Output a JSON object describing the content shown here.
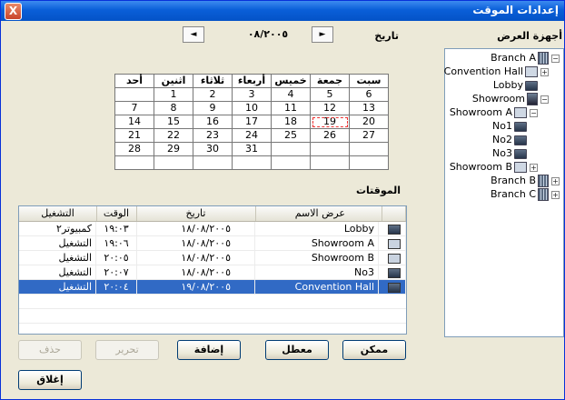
{
  "window": {
    "title": "إعدادات الموقت",
    "close_label": "X"
  },
  "devices": {
    "label": "أجهزة العرض",
    "items": [
      {
        "name": "Branch A",
        "icon": "building-icon",
        "expander": "−"
      },
      {
        "name": "Convention Hall",
        "icon": "display-icon",
        "expander": "+"
      },
      {
        "name": "Lobby",
        "icon": "video-icon",
        "expander": ""
      },
      {
        "name": "Showroom",
        "icon": "showroom-icon",
        "expander": "−"
      },
      {
        "name": "Showroom A",
        "icon": "display-icon",
        "expander": "−"
      },
      {
        "name": "No1",
        "icon": "video-icon",
        "expander": ""
      },
      {
        "name": "No2",
        "icon": "video-icon",
        "expander": ""
      },
      {
        "name": "No3",
        "icon": "video-icon",
        "expander": ""
      },
      {
        "name": "Showroom B",
        "icon": "display-icon",
        "expander": "+"
      },
      {
        "name": "Branch B",
        "icon": "building-icon",
        "expander": "+"
      },
      {
        "name": "Branch C",
        "icon": "building-icon",
        "expander": "+"
      }
    ]
  },
  "date_section": {
    "label": "تاريخ",
    "month_label": "٠٨/٢٠٠٥",
    "prev_icon": "◄",
    "next_icon": "►"
  },
  "calendar": {
    "weekdays": [
      "سبت",
      "جمعة",
      "خميس",
      "أربعاء",
      "ثلاثاء",
      "اثنين",
      "أحد"
    ],
    "weeks": [
      [
        "6",
        "5",
        "4",
        "3",
        "2",
        "1",
        ""
      ],
      [
        "13",
        "12",
        "11",
        "10",
        "9",
        "8",
        "7"
      ],
      [
        "20",
        "19",
        "18",
        "17",
        "16",
        "15",
        "14"
      ],
      [
        "27",
        "26",
        "25",
        "24",
        "23",
        "22",
        "21"
      ],
      [
        "",
        "",
        "",
        "31",
        "30",
        "29",
        "28"
      ],
      [
        "",
        "",
        "",
        "",
        "",
        "",
        ""
      ]
    ],
    "selected_day": "19"
  },
  "timers": {
    "label": "الموقتات",
    "columns": {
      "name": "عرض الاسم",
      "date": "تاريخ",
      "time": "الوقت",
      "action": "التشغيل"
    },
    "rows": [
      {
        "icon": "video-icon",
        "name": "Lobby",
        "date": "١٨/٠٨/٢٠٠٥",
        "time": "١٩:٠٣",
        "action": "كمبيوتر٢"
      },
      {
        "icon": "display-icon",
        "name": "Showroom A",
        "date": "١٨/٠٨/٢٠٠٥",
        "time": "١٩:٠٦",
        "action": "التشغيل"
      },
      {
        "icon": "display-icon",
        "name": "Showroom B",
        "date": "١٨/٠٨/٢٠٠٥",
        "time": "٢٠:٠٥",
        "action": "التشغيل"
      },
      {
        "icon": "video-icon",
        "name": "No3",
        "date": "١٨/٠٨/٢٠٠٥",
        "time": "٢٠:٠٧",
        "action": "التشغيل"
      },
      {
        "icon": "video-icon",
        "name": "Convention Hall",
        "date": "١٩/٠٨/٢٠٠٥",
        "time": "٢٠:٠٤",
        "action": "التشغيل",
        "selected": true
      }
    ]
  },
  "buttons": {
    "enable": "ممكن",
    "disable": "معطل",
    "add": "إضافة",
    "edit": "تحرير",
    "delete": "حذف",
    "close": "إغلاق"
  }
}
